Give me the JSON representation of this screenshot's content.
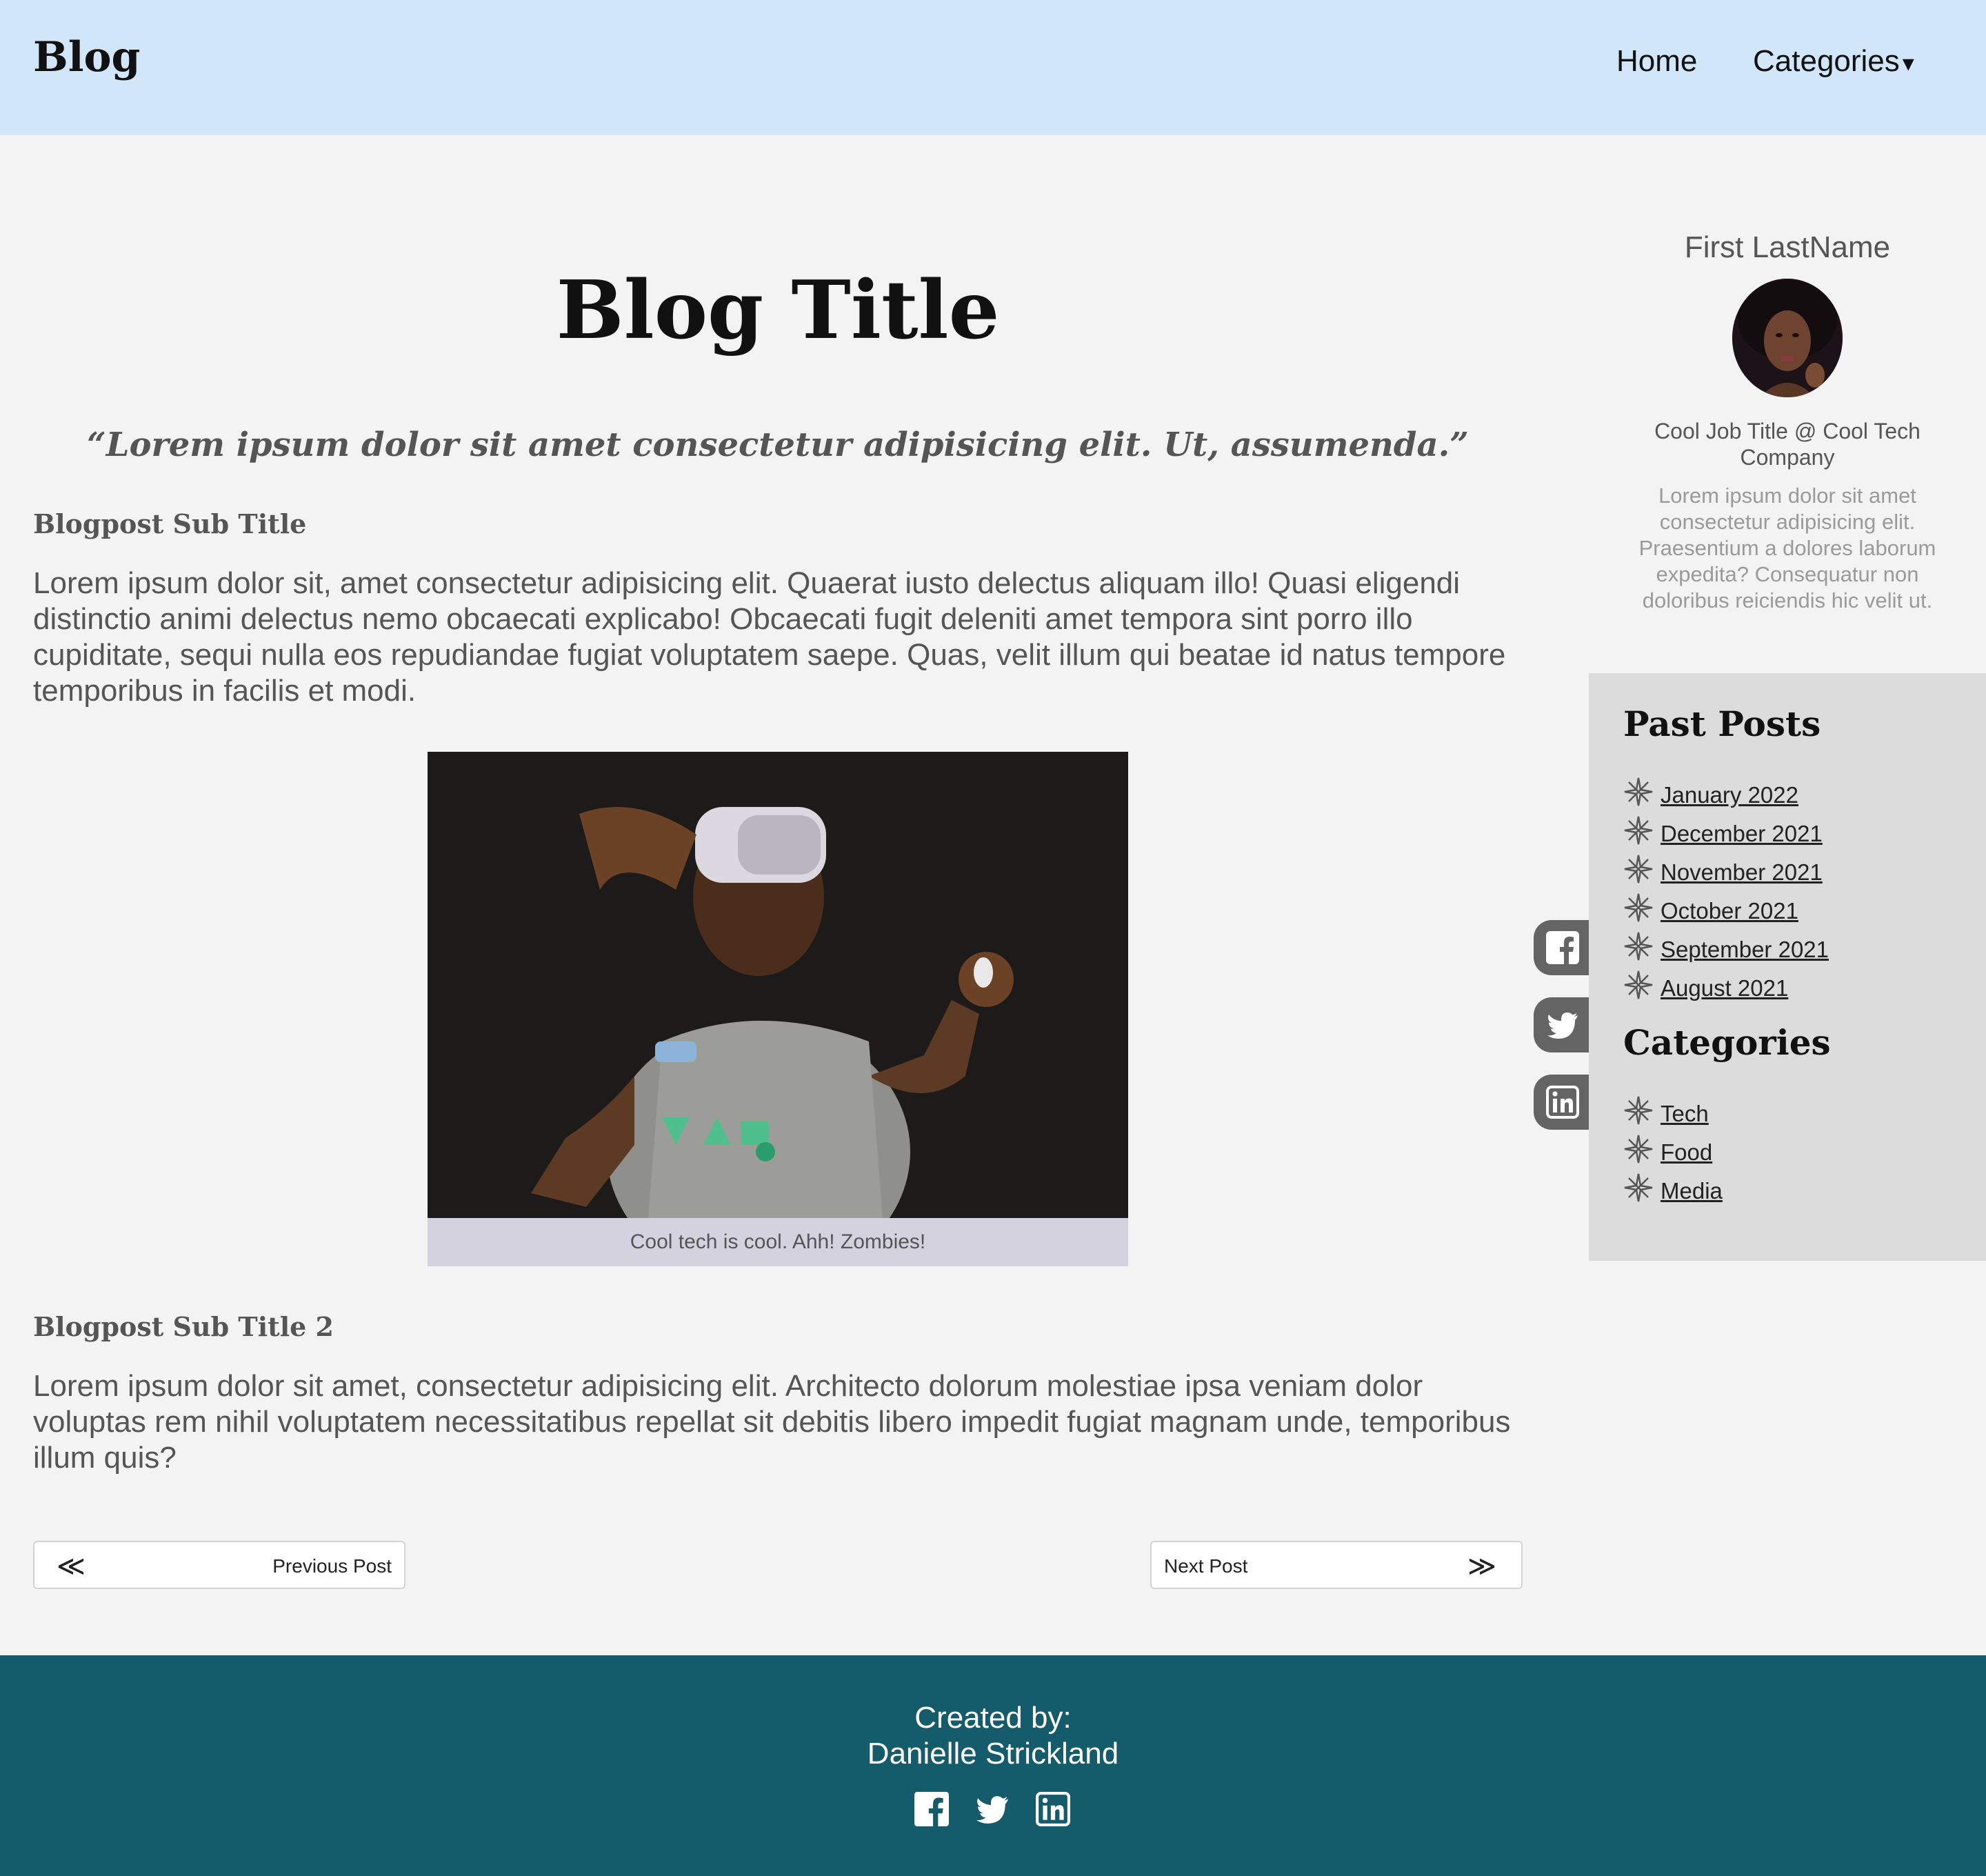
{
  "header": {
    "brand": "Blog",
    "nav": {
      "home": "Home",
      "categories": "Categories",
      "caret": "▾"
    }
  },
  "article": {
    "title": "Blog Title",
    "quote": "“Lorem ipsum dolor sit amet consectetur adipisicing elit. Ut, assumenda.”",
    "subtitle1": "Blogpost Sub Title",
    "paragraph1": "Lorem ipsum dolor sit, amet consectetur adipisicing elit. Quaerat iusto delectus aliquam illo! Quasi eligendi distinctio animi delectus nemo obcaecati explicabo! Obcaecati fugit deleniti amet tempora sint porro illo cupiditate, sequi nulla eos repudiandae fugiat voluptatem saepe. Quas, velit illum qui beatae id natus tempore temporibus in facilis et modi.",
    "caption": "Cool tech is cool. Ahh! Zombies!",
    "subtitle2": "Blogpost Sub Title 2",
    "paragraph2": "Lorem ipsum dolor sit amet, consectetur adipisicing elit. Architecto dolorum molestiae ipsa veniam dolor voluptas rem nihil voluptatem necessitatibus repellat sit debitis libero impedit fugiat magnam unde, temporibus illum quis?",
    "prev": {
      "arrow": "≪",
      "label": "Previous Post"
    },
    "next": {
      "arrow": "≫",
      "label": "Next Post"
    }
  },
  "profile": {
    "name": "First LastName",
    "job": "Cool Job Title @ Cool Tech Company",
    "bio": "Lorem ipsum dolor sit amet consectetur adipisicing elit. Praesentium a dolores laborum expedita? Consequatur non doloribus reiciendis hic velit ut."
  },
  "sidebar": {
    "past_posts_heading": "Past Posts",
    "past_posts": [
      "January 2022",
      "December 2021",
      "November 2021",
      "October 2021",
      "September 2021",
      "August 2021"
    ],
    "categories_heading": "Categories",
    "categories": [
      "Tech",
      "Food",
      "Media"
    ]
  },
  "side_social": [
    "facebook-icon",
    "twitter-icon",
    "linkedin-icon"
  ],
  "footer": {
    "created_by": "Created by:",
    "author": "Danielle Strickland",
    "icons": [
      "facebook-icon",
      "twitter-icon",
      "linkedin-icon"
    ]
  },
  "colors": {
    "header_bg": "#d2e6f9",
    "page_bg": "#f3f3f3",
    "sidebar_bg": "#dcdcdc",
    "footer_bg": "#145b6b",
    "caption_bg": "#d3d2de",
    "social_tab": "#646464"
  }
}
